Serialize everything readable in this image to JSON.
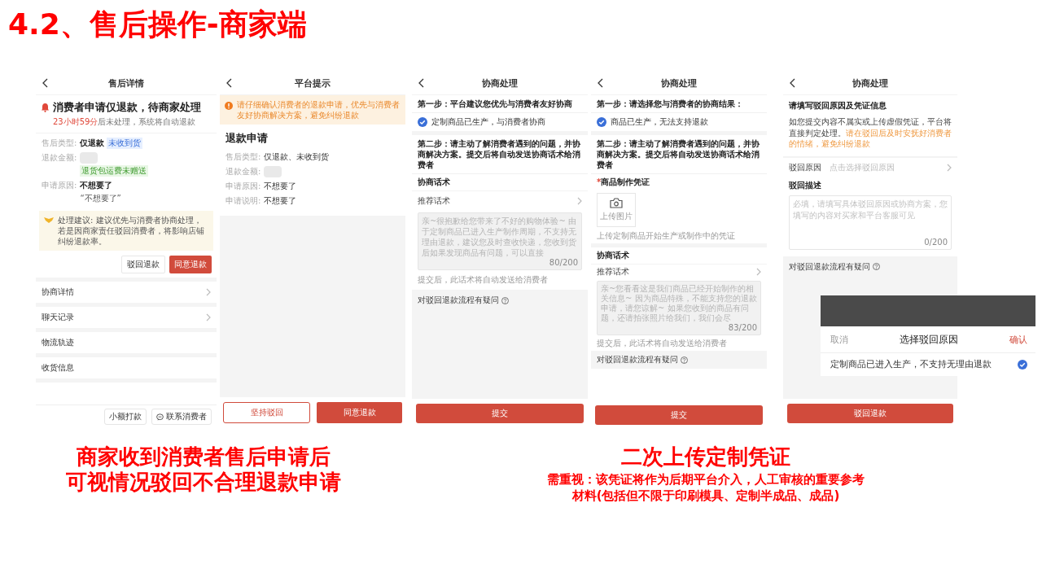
{
  "slide_title": "4.2、售后操作-商家端",
  "panels": [
    {
      "title": "售后详情",
      "blocks": [
        {
          "kind": "status",
          "title": "消费者申请仅退款，待商家处理",
          "countdown": "23小时59分",
          "note": "后未处理，系统将自动退款"
        },
        {
          "kind": "fields",
          "rows": [
            {
              "kind": "text",
              "label": "售后类型:",
              "value": "仅退款",
              "tag": "未收到货"
            },
            {
              "kind": "blurred",
              "label": "退款金额:",
              "sub_tag": "退货包运费未赠送"
            },
            {
              "kind": "text",
              "label": "申请原因:",
              "value": "不想要了",
              "quote": "“不想要了”"
            }
          ]
        },
        {
          "kind": "advice",
          "text": "处理建议: 建议优先与消费者协商处理，若是因商家责任驳回消费者，将影响店铺纠纷退款率。"
        },
        {
          "kind": "actions",
          "buttons": [
            {
              "label": "驳回退款",
              "kind": "secondary"
            },
            {
              "label": "同意退款",
              "kind": "primary"
            }
          ]
        },
        {
          "kind": "menu",
          "items": [
            {
              "label": "协商详情",
              "arrow": true
            },
            {
              "label": "聊天记录",
              "arrow": true
            },
            {
              "label": "物流轨迹",
              "arrow": false
            },
            {
              "label": "收货信息",
              "arrow": false
            }
          ]
        }
      ],
      "footer": {
        "kind": "bar",
        "buttons": [
          {
            "label": "小额打款",
            "kind": "plain"
          },
          {
            "label": "联系消费者",
            "kind": "chat"
          }
        ]
      }
    },
    {
      "title": "平台提示",
      "blocks": [
        {
          "kind": "banner",
          "text": "请仔细确认消费者的退款申请，优先与消费者友好协商解决方案，避免纠纷退款"
        },
        {
          "kind": "section_title",
          "text": "退款申请"
        },
        {
          "kind": "fields",
          "rows": [
            {
              "kind": "text",
              "label": "售后类型:",
              "value": "仅退款、未收到货"
            },
            {
              "kind": "blurred",
              "label": "退款金额:"
            },
            {
              "kind": "text",
              "label": "申请原因:",
              "value": "不想要了"
            },
            {
              "kind": "text",
              "label": "申请说明:",
              "value": "不想要了"
            }
          ]
        },
        {
          "kind": "filler"
        }
      ],
      "footer": {
        "kind": "split",
        "buttons": [
          {
            "label": "坚持驳回",
            "kind": "secondary"
          },
          {
            "label": "同意退款",
            "kind": "primary"
          }
        ]
      }
    },
    {
      "title": "协商处理",
      "blocks": [
        {
          "kind": "step",
          "text": "第一步：平台建议您优先与消费者友好协商"
        },
        {
          "kind": "option",
          "label": "定制商品已生产，与消费者协商",
          "checked": true
        },
        {
          "kind": "gap"
        },
        {
          "kind": "step",
          "text": "第二步：请主动了解消费者遇到的问题，并协商解决方案。提交后将自动发送协商话术给消费者"
        },
        {
          "kind": "label",
          "text": "协商话术"
        },
        {
          "kind": "link_row",
          "label": "推荐话术",
          "arrow": true
        },
        {
          "kind": "textarea",
          "value": "亲~很抱歉给您带来了不好的购物体验~ 由于定制商品已进入生产制作周期，不支持无理由退款，建议您及时查收快递，您收到货后如果发现商品有问题，可以直接",
          "counter": "80/200"
        },
        {
          "kind": "hint",
          "text": "提交后，此话术将自动发送给消费者"
        },
        {
          "kind": "help",
          "text": "对驳回退款流程有疑问"
        }
      ],
      "footer": {
        "kind": "full",
        "buttons": [
          {
            "label": "提交",
            "kind": "primary"
          }
        ]
      }
    },
    {
      "title": "协商处理",
      "blocks": [
        {
          "kind": "step",
          "text": "第一步：请选择您与消费者的协商结果："
        },
        {
          "kind": "option",
          "label": "商品已生产，无法支持退款",
          "checked": true
        },
        {
          "kind": "gap"
        },
        {
          "kind": "step",
          "text": "第二步：请主动了解消费者遇到的问题，并协商解决方案。提交后将自动发送协商话术给消费者"
        },
        {
          "kind": "label",
          "text": "商品制作凭证",
          "required_mark": "*"
        },
        {
          "kind": "upload",
          "label": "上传图片"
        },
        {
          "kind": "hint",
          "text": "上传定制商品开始生产或制作中的凭证"
        },
        {
          "kind": "gap"
        },
        {
          "kind": "label",
          "text": "协商话术"
        },
        {
          "kind": "link_row",
          "label": "推荐话术",
          "arrow": true
        },
        {
          "kind": "textarea",
          "value": "亲~您看看这是我们商品已经开始制作的相关信息~ 因为商品特殊，不能支持您的退款申请，请您谅解~ 如果您收到的商品有问题，还请拍张照片给我们，我们会尽",
          "counter": "83/200"
        },
        {
          "kind": "hint",
          "text": "提交后，此话术将自动发送给消费者"
        },
        {
          "kind": "help",
          "text": "对驳回退款流程有疑问"
        }
      ],
      "footer": {
        "kind": "full",
        "buttons": [
          {
            "label": "提交",
            "kind": "primary"
          }
        ]
      }
    },
    {
      "title": "协商处理",
      "blocks": [
        {
          "kind": "heading",
          "text": "请填写驳回原因及凭证信息"
        },
        {
          "kind": "paragraph",
          "text": "如您提交内容不属实或上传虚假凭证，平台将直接判定处理。",
          "emphasis": "请在驳回后及时安抚好消费者的情绪，避免纠纷退款"
        },
        {
          "kind": "link_row",
          "label": "驳回原因",
          "placeholder": "点击选择驳回原因",
          "arrow": true
        },
        {
          "kind": "label",
          "text": "驳回描述"
        },
        {
          "kind": "textarea",
          "placeholder": "必填，请填写具体驳回原因或协商方案，您填写的内容对买家和平台客服可见",
          "counter": "0/200"
        },
        {
          "kind": "help",
          "text": "对驳回退款流程有疑问"
        }
      ],
      "footer": {
        "kind": "full",
        "buttons": [
          {
            "label": "驳回退款",
            "kind": "primary"
          }
        ]
      },
      "popup": {
        "cancel": "取消",
        "title": "选择驳回原因",
        "confirm": "确认",
        "options": [
          {
            "label": "定制商品已进入生产，不支持无理由退款",
            "selected": true
          }
        ]
      }
    }
  ],
  "captions": [
    {
      "lines": [
        "商家收到消费者售后申请后",
        "可视情况驳回不合理退款申请"
      ]
    },
    {
      "lines": [
        "二次上传定制凭证"
      ],
      "note": "需重视：该凭证将作为后期平台介入，人工审核的重要参考材料(包括但不限于印刷模具、定制半成品、成品)"
    }
  ]
}
